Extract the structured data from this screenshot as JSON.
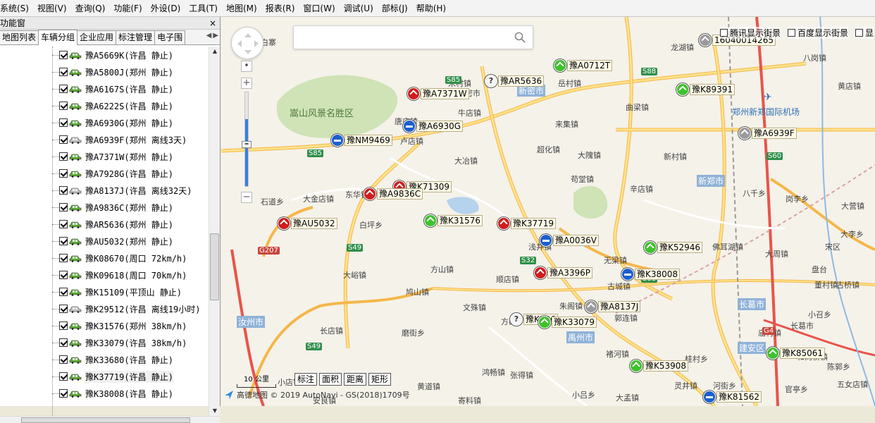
{
  "menu": [
    "系统(S)",
    "视图(V)",
    "查询(Q)",
    "功能(F)",
    "外设(D)",
    "工具(T)",
    "地图(M)",
    "报表(R)",
    "窗口(W)",
    "调试(U)",
    "部标(J)",
    "帮助(H)"
  ],
  "panel": {
    "title": "功能窗",
    "close": "×",
    "tabs": [
      "地图列表",
      "车辆分组",
      "企业应用",
      "标注管理",
      "电子围"
    ],
    "active_tab": 1,
    "vehicles": [
      {
        "text": "豫A5669K(许昌 静止)",
        "online": true
      },
      {
        "text": "豫A5800J(郑州 静止)",
        "online": true
      },
      {
        "text": "豫A6167S(许昌 静止)",
        "online": true
      },
      {
        "text": "豫A6222S(许昌 静止)",
        "online": true
      },
      {
        "text": "豫A6930G(郑州 静止)",
        "online": true
      },
      {
        "text": "豫A6939F(郑州 离线3天)",
        "online": false
      },
      {
        "text": "豫A7371W(郑州 静止)",
        "online": true
      },
      {
        "text": "豫A7928G(许昌 静止)",
        "online": true
      },
      {
        "text": "豫A8137J(许昌 离线32天)",
        "online": false
      },
      {
        "text": "豫A9836C(郑州 静止)",
        "online": true
      },
      {
        "text": "豫AR5636(郑州 静止)",
        "online": true
      },
      {
        "text": "豫AU5032(郑州 静止)",
        "online": true
      },
      {
        "text": "豫K08670(周口 72km/h)",
        "online": true
      },
      {
        "text": "豫K09618(周口 70km/h)",
        "online": true
      },
      {
        "text": "豫K15109(平顶山 静止)",
        "online": true
      },
      {
        "text": "豫K29512(许昌 离线19小时)",
        "online": false
      },
      {
        "text": "豫K31576(郑州 38km/h)",
        "online": true
      },
      {
        "text": "豫K33079(许昌 38km/h)",
        "online": true
      },
      {
        "text": "豫K33680(许昌 静止)",
        "online": true
      },
      {
        "text": "豫K37719(许昌 静止)",
        "online": true
      },
      {
        "text": "豫K38008(许昌 静止)",
        "online": true
      }
    ]
  },
  "map": {
    "street_options": [
      "腾讯显示街景",
      "百度显示街景",
      "显"
    ],
    "tools": [
      "标注",
      "面积",
      "距离",
      "矩形"
    ],
    "scale": "10 公里",
    "copyright": "高德地图 © 2019 AutoNavi - GS(2018)1709号",
    "vehicles": [
      {
        "label": "16040014265",
        "color": "gray"
      },
      {
        "label": "豫A0712T",
        "color": "green"
      },
      {
        "label": "豫AR5636",
        "color": "white"
      },
      {
        "label": "豫A7371W",
        "color": "red"
      },
      {
        "label": "豫K89391",
        "color": "green"
      },
      {
        "label": "豫A6930G",
        "color": "blue"
      },
      {
        "label": "豫A6939F",
        "color": "gray"
      },
      {
        "label": "豫NM9469",
        "color": "blue"
      },
      {
        "label": "豫K71309",
        "color": "red"
      },
      {
        "label": "豫A9836C",
        "color": "red"
      },
      {
        "label": "豫AU5032",
        "color": "red"
      },
      {
        "label": "豫K31576",
        "color": "green"
      },
      {
        "label": "豫K37719",
        "color": "red"
      },
      {
        "label": "豫A0036V",
        "color": "blue"
      },
      {
        "label": "豫K52946",
        "color": "green"
      },
      {
        "label": "豫A3396P",
        "color": "red"
      },
      {
        "label": "豫K38008",
        "color": "blue"
      },
      {
        "label": "豫A8137J",
        "color": "gray"
      },
      {
        "label": "豫K336",
        "color": "white"
      },
      {
        "label": "豫K33079",
        "color": "green"
      },
      {
        "label": "豫K85061",
        "color": "green"
      },
      {
        "label": "豫K53908",
        "color": "green"
      },
      {
        "label": "豫K81562",
        "color": "blue"
      }
    ],
    "places": [
      "白寨",
      "米村镇",
      "新密市",
      "岳村镇",
      "龙湖镇",
      "八岗镇",
      "黄店镇",
      "曲梁镇",
      "来集镇",
      "牛店镇",
      "唐庄镇",
      "卢店镇",
      "大冶镇",
      "超化镇",
      "大隗镇",
      "苟堂镇",
      "新村镇",
      "辛店镇",
      "八千乡",
      "岗李乡",
      "大金店镇",
      "东华镇",
      "石道乡",
      "白坪乡",
      "浅井镇",
      "无梁镇",
      "古城镇",
      "佛耳湖镇",
      "大周镇",
      "董村镇",
      "古桥镇",
      "方山镇",
      "大峪镇",
      "顺店镇",
      "鸠山镇",
      "文殊镇",
      "朱阁镇",
      "郭连镇",
      "庙村镇",
      "磨街乡",
      "方山",
      "褚河镇",
      "桂村乡",
      "张得镇",
      "黄道镇",
      "鸿畅镇",
      "小吕乡",
      "灵井镇",
      "河街乡",
      "陈郭乡",
      "五女店镇",
      "长葛市",
      "和尚桥镇",
      "小召乡",
      "宋区",
      "大李乡",
      "大营镇",
      "盘台",
      "官亭乡",
      "长店镇",
      "小店镇",
      "安良镇",
      "寄料镇",
      "大孟镇"
    ],
    "districts": [
      "新密市",
      "新郑市",
      "禹州市",
      "长葛市",
      "汝州市",
      "建安区"
    ],
    "scenic": "嵩山风景名胜区",
    "airport": "郑州新郑国际机场",
    "roads": [
      "S85",
      "S88",
      "S85",
      "S49",
      "S32",
      "S88",
      "G4",
      "S49",
      "S60",
      "G207"
    ]
  }
}
